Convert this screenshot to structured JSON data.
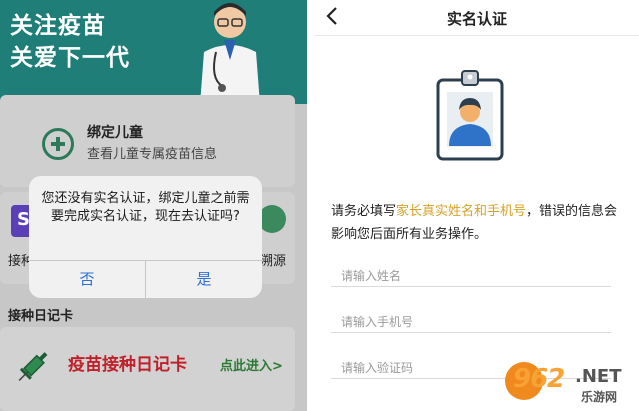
{
  "left": {
    "banner": {
      "title": "关注疫苗\n关爱下一代"
    },
    "bind_child": {
      "title": "绑定儿童",
      "subtitle": "查看儿童专属疫苗信息"
    },
    "grid": {
      "label_left": "接种",
      "label_right": "溯源"
    },
    "diary": {
      "heading": "接种日记卡",
      "card_title": "疫苗接种日记卡",
      "enter": "点此进入>"
    },
    "dialog": {
      "message": "您还没有实名认证，绑定儿童之前需要完成实名认证，现在去认证吗?",
      "cancel": "否",
      "confirm": "是"
    }
  },
  "right": {
    "header": {
      "back_icon": "chevron-left-icon",
      "title": "实名认证"
    },
    "notice": {
      "prefix": "请务必填写",
      "highlight": "家长真实姓名和手机号",
      "suffix": "，错误的信息会影响您后面所有业务操作。",
      "highlight_color": "#d7a227"
    },
    "form": {
      "name_placeholder": "请输入姓名",
      "phone_placeholder": "请输入手机号",
      "code_placeholder": "请输入验证码"
    }
  },
  "watermark": {
    "number": "962",
    "net": ".NET",
    "cn": "乐游网"
  },
  "colors": {
    "banner": "#1f7f78",
    "dialog_button": "#2f6fd6",
    "diary_title": "#c0202a",
    "enter_link": "#2c7a35"
  }
}
